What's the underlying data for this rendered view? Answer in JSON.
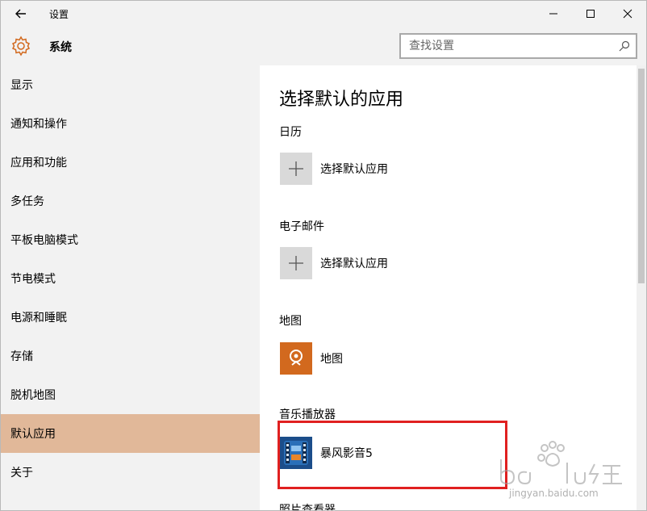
{
  "window": {
    "title": "设置",
    "controls": {
      "minimize_icon": "minimize-icon",
      "maximize_icon": "maximize-icon",
      "close_icon": "close-icon"
    }
  },
  "header": {
    "icon": "gear-icon",
    "title": "系统",
    "search": {
      "placeholder": "查找设置",
      "icon": "search-icon"
    }
  },
  "sidebar": {
    "items": [
      {
        "label": "显示"
      },
      {
        "label": "通知和操作"
      },
      {
        "label": "应用和功能"
      },
      {
        "label": "多任务"
      },
      {
        "label": "平板电脑模式"
      },
      {
        "label": "节电模式"
      },
      {
        "label": "电源和睡眠"
      },
      {
        "label": "存储"
      },
      {
        "label": "脱机地图"
      },
      {
        "label": "默认应用",
        "active": true
      },
      {
        "label": "关于"
      }
    ],
    "active_color": "#e1b899"
  },
  "main": {
    "title": "选择默认的应用",
    "sections": [
      {
        "category": "日历",
        "app": "选择默认应用",
        "icon": "plus-icon"
      },
      {
        "category": "电子邮件",
        "app": "选择默认应用",
        "icon": "plus-icon"
      },
      {
        "category": "地图",
        "app": "地图",
        "icon": "maps-icon"
      },
      {
        "category": "音乐播放器",
        "app": "暴风影音5",
        "icon": "baofeng-icon"
      },
      {
        "category": "照片查看器"
      }
    ]
  },
  "annotation": {
    "color": "#e02020"
  },
  "watermark": {
    "logo_text": "Baidu经验",
    "url": "jingyan.baidu.com"
  }
}
